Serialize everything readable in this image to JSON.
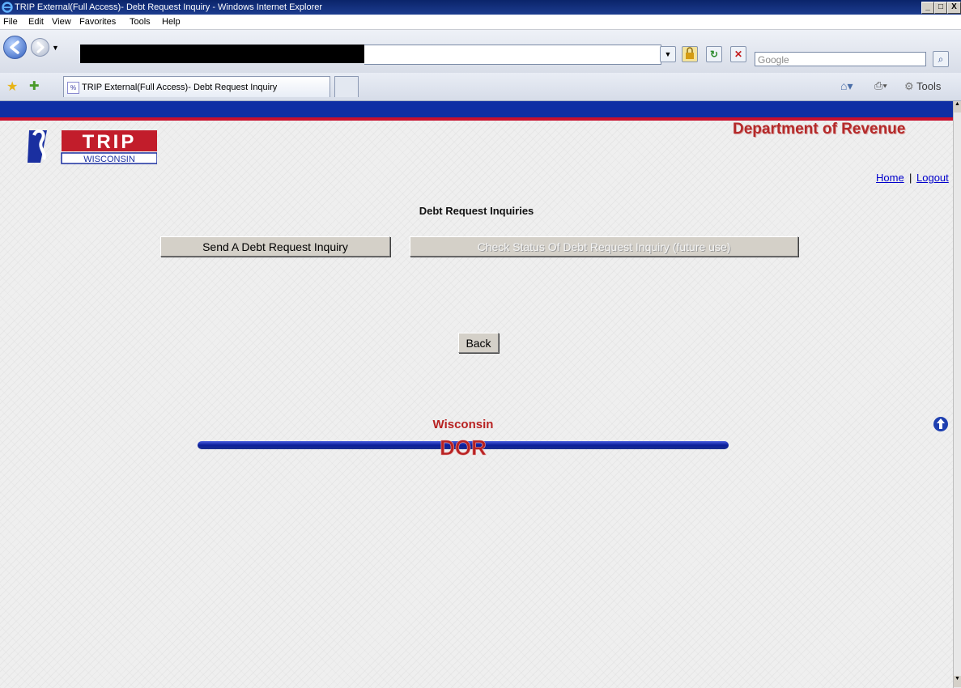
{
  "window": {
    "title": "TRIP External(Full Access)- Debt Request Inquiry - Windows Internet Explorer",
    "controls": {
      "minimize": "_",
      "maximize": "□",
      "close": "X"
    }
  },
  "menu": {
    "items": [
      "File",
      "Edit",
      "View",
      "Favorites",
      "Tools",
      "Help"
    ]
  },
  "address_bar": {
    "url": "",
    "search_placeholder": "Google"
  },
  "tabs": {
    "active_label": "TRIP External(Full Access)- Debt Request Inquiry"
  },
  "command_bar": {
    "tools_label": "Tools"
  },
  "page": {
    "logo": {
      "word": "TRIP",
      "sub": "WISCONSIN"
    },
    "department": "Department of Revenue",
    "links": {
      "home": "Home",
      "separator": "|",
      "logout": "Logout"
    },
    "heading": "Debt Request Inquiries",
    "buttons": {
      "send": "Send A Debt Request Inquiry",
      "status": "Check Status Of Debt Request Inquiry (future use)",
      "back": "Back"
    },
    "footer_logo": {
      "top": "Wisconsin",
      "bottom": "DOR"
    }
  },
  "colors": {
    "header_blue": "#0f2fa4",
    "header_red": "#c8102e",
    "dept_red": "#b42a2a",
    "link_blue": "#0000cc"
  }
}
